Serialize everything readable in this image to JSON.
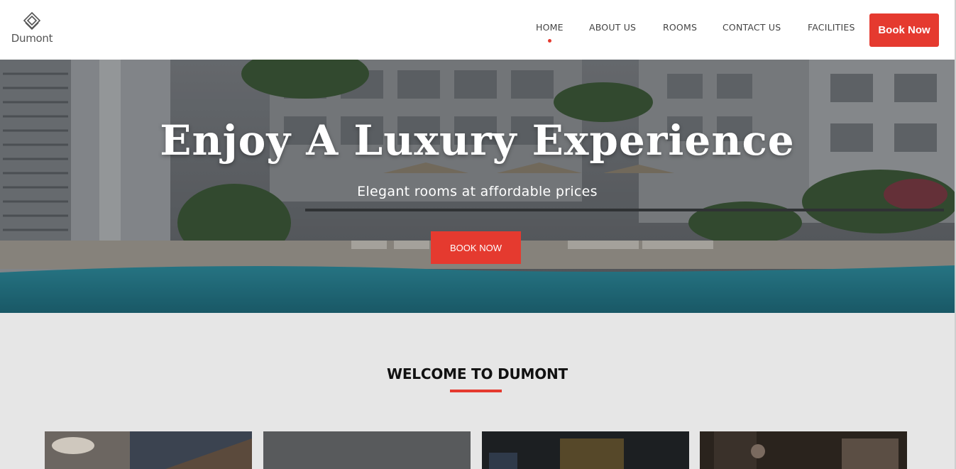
{
  "brand": {
    "name": "Dumont",
    "logo_icon": "layered-diamond-icon"
  },
  "nav": {
    "items": [
      {
        "label": "HOME",
        "active": true
      },
      {
        "label": "ABOUT US",
        "active": false
      },
      {
        "label": "ROOMS",
        "active": false
      },
      {
        "label": "CONTACT US",
        "active": false
      },
      {
        "label": "FACILITIES",
        "active": false
      }
    ],
    "cta": "Book Now"
  },
  "hero": {
    "title": "Enjoy A Luxury Experience",
    "subtitle": "Elegant rooms at affordable prices",
    "button": "BOOK NOW"
  },
  "welcome": {
    "title": "WELCOME TO DUMONT"
  },
  "colors": {
    "accent": "#e53a2f",
    "section_bg": "#e6e6e6",
    "header_bg": "#ffffff"
  }
}
